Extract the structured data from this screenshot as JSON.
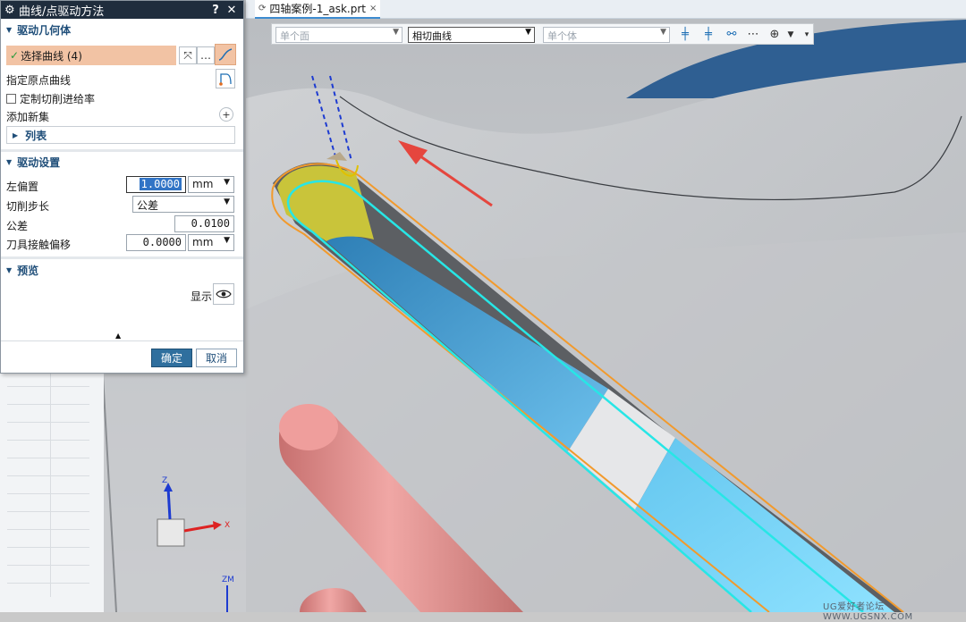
{
  "dialog": {
    "title": "曲线/点驱动方法",
    "help_label": "?",
    "close_label": "✕",
    "drive_geometry": {
      "header": "驱动几何体",
      "select_curve_label": "选择曲线 (4)",
      "specify_origin_label": "指定原点曲线",
      "custom_feed_label": "定制切削进给率",
      "add_new_set_label": "添加新集",
      "list_label": "列表"
    },
    "drive_settings": {
      "header": "驱动设置",
      "left_offset_label": "左偏置",
      "left_offset_value": "1.0000",
      "left_offset_unit": "mm",
      "cut_step_label": "切削步长",
      "cut_step_value": "公差",
      "tolerance_label": "公差",
      "tolerance_value": "0.0100",
      "tool_contact_label": "刀具接触偏移",
      "tool_contact_value": "0.0000",
      "tool_contact_unit": "mm"
    },
    "preview": {
      "header": "预览",
      "display_label": "显示"
    },
    "ok_label": "确定",
    "cancel_label": "取消"
  },
  "document_tab": {
    "label": "四轴案例-1_ask.prt",
    "close_label": "×"
  },
  "selection_bar": {
    "face_filter": "单个面",
    "curve_rule": "相切曲线",
    "body_filter": "单个体"
  },
  "axes": {
    "z_label": "Z",
    "x_label": "X",
    "zm_label": "ZM"
  },
  "watermark": "UG爱好者论坛 WWW.UGSNX.COM",
  "colors": {
    "dialog_title_bg": "#1f2d3d",
    "selected_row_bg": "#f2c3a4",
    "ok_button": "#2f6f9e",
    "pink_cylinder": "#e89a98",
    "cyan_curve": "#27e6e6",
    "slot_blue": "#4aa8dc"
  }
}
